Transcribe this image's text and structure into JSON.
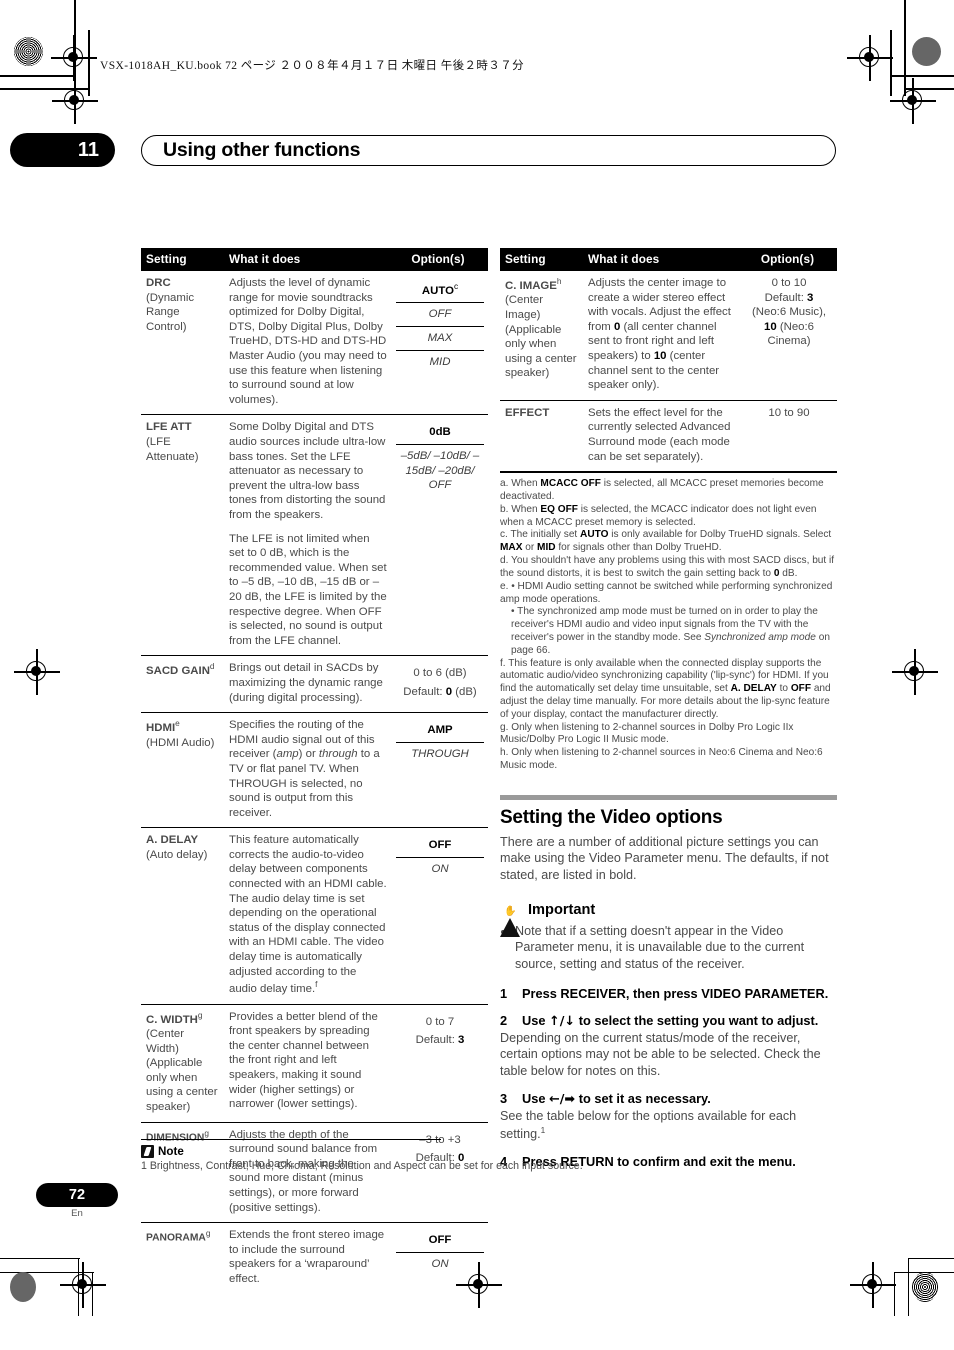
{
  "print_header": "VSX-1018AH_KU.book   72 ページ   ２００８年４月１７日   木曜日   午後２時３７分",
  "chapter": {
    "number": "11",
    "title": "Using other functions"
  },
  "left_table": {
    "headers": {
      "setting": "Setting",
      "what": "What it does",
      "options": "Option(s)"
    },
    "rows": [
      {
        "setting": "DRC",
        "setting_sup": "",
        "setting_sub": "(Dynamic Range Control)",
        "what": "Adjusts the level of dynamic range for movie soundtracks optimized for Dolby Digital, DTS, Dolby Digital Plus, Dolby TrueHD, DTS-HD and DTS-HD Master Audio (you may need to use this feature when listening to surround sound at low volumes).",
        "what2": "",
        "option_lines": [
          {
            "text": "AUTO",
            "sup": "c",
            "bold": true,
            "italic": false
          },
          {
            "text": "OFF",
            "sup": "",
            "bold": false,
            "italic": true
          },
          {
            "text": "MAX",
            "sup": "",
            "bold": false,
            "italic": true
          },
          {
            "text": "MID",
            "sup": "",
            "bold": false,
            "italic": true
          }
        ]
      },
      {
        "setting": "LFE ATT",
        "setting_sup": "",
        "setting_sub": "(LFE Attenuate)",
        "what": "Some Dolby Digital and DTS audio sources include ultra-low bass tones. Set the LFE attenuator as necessary to prevent the ultra-low bass tones from distorting the sound from the speakers.",
        "what2": "The LFE is not limited when set to 0 dB, which is the recommended value. When set to –5 dB, –10 dB, –15 dB or –20 dB, the LFE is limited by the respective degree. When OFF is selected, no sound is output from the LFE channel.",
        "option_lines": [
          {
            "text": "0dB",
            "sup": "",
            "bold": true,
            "italic": false
          },
          {
            "text": "–5dB/ –10dB/ –15dB/ –20dB/ OFF",
            "sup": "",
            "bold": false,
            "italic": true
          }
        ]
      },
      {
        "setting": "SACD GAIN",
        "setting_sup": "d",
        "setting_sub": "",
        "what": "Brings out detail in SACDs by maximizing the dynamic range (during digital processing).",
        "what2": "",
        "option_plain": "0 to 6 (dB)",
        "option_plain2_pre": "Default: ",
        "option_plain2_bold": "0",
        "option_plain2_post": " (dB)"
      },
      {
        "setting": "HDMI",
        "setting_sup": "e",
        "setting_sub": "(HDMI Audio)",
        "what": "Specifies the routing of the HDMI audio signal out of this receiver (amp) or through to a TV or flat panel TV. When THROUGH is selected, no sound is output from this receiver.",
        "what2": "",
        "option_lines": [
          {
            "text": "AMP",
            "sup": "",
            "bold": true,
            "italic": false
          },
          {
            "text": "THROUGH",
            "sup": "",
            "bold": false,
            "italic": true
          }
        ]
      },
      {
        "setting": "A. DELAY",
        "setting_sup": "",
        "setting_sub": "(Auto delay)",
        "what": "This feature automatically corrects the audio-to-video delay between components connected with an HDMI cable. The audio delay time is set depending on the operational status of the display connected with an HDMI cable. The video delay time is automatically adjusted according to the audio delay time.",
        "what_sup": "f",
        "what2": "",
        "option_lines": [
          {
            "text": "OFF",
            "sup": "",
            "bold": true,
            "italic": false
          },
          {
            "text": "ON",
            "sup": "",
            "bold": false,
            "italic": true
          }
        ]
      },
      {
        "setting": "C. WIDTH",
        "setting_sup": "g",
        "setting_sub": "(Center Width) (Applicable only when using a center speaker)",
        "what": "Provides a better blend of the front speakers by spreading the center channel between the front right and left speakers, making it sound wider (higher settings) or narrower (lower settings).",
        "what2": "",
        "option_plain": "0 to 7",
        "option_plain2_pre": "Default: ",
        "option_plain2_bold": "3",
        "option_plain2_post": ""
      },
      {
        "setting": "DIMENSION",
        "setting_sup": "g",
        "setting_sub": "",
        "setting_small": true,
        "what": "Adjusts the depth of the surround sound balance from front to back, making the sound more distant (minus settings), or more forward (positive settings).",
        "what2": "",
        "option_plain": "–3 to +3",
        "option_plain2_pre": "Default: ",
        "option_plain2_bold": "0",
        "option_plain2_post": ""
      },
      {
        "setting": "PANORAMA",
        "setting_sup": "g",
        "setting_sub": "",
        "setting_small": true,
        "what": "Extends the front stereo image to include the surround speakers for a ‘wraparound’ effect.",
        "what2": "",
        "option_lines": [
          {
            "text": "OFF",
            "sup": "",
            "bold": true,
            "italic": false
          },
          {
            "text": "ON",
            "sup": "",
            "bold": false,
            "italic": true
          }
        ]
      }
    ]
  },
  "right_table": {
    "headers": {
      "setting": "Setting",
      "what": "What it does",
      "options": "Option(s)"
    },
    "rows": [
      {
        "setting": "C. IMAGE",
        "setting_sup": "h",
        "setting_sub": "(Center Image) (Applicable only when using a center speaker)",
        "what_parts": [
          {
            "t": "Adjusts the center image to create a wider stereo effect with vocals. Adjust the effect from ",
            "b": false
          },
          {
            "t": "0",
            "b": true
          },
          {
            "t": " (all center channel sent to front right and left speakers) to ",
            "b": false
          },
          {
            "t": "10",
            "b": true
          },
          {
            "t": " (center channel sent to the center speaker only).",
            "b": false
          }
        ],
        "option_parts": [
          {
            "t": "0 to 10",
            "b": false
          },
          {
            "t": "Default: ",
            "b": false,
            "nl": true
          },
          {
            "t": "3",
            "b": true
          },
          {
            "t": "(Neo:6 Music), ",
            "b": false,
            "nl": true
          },
          {
            "t": "10",
            "b": true
          },
          {
            "t": " (Neo:6 Cinema)",
            "b": false
          }
        ]
      },
      {
        "setting": "EFFECT",
        "setting_sup": "",
        "setting_sub": "",
        "what_parts": [
          {
            "t": "Sets the effect level for the currently selected Advanced Surround mode (each mode can be set separately).",
            "b": false
          }
        ],
        "option_parts": [
          {
            "t": "10 to 90",
            "b": false
          }
        ]
      }
    ]
  },
  "footnotes": [
    {
      "parts": [
        {
          "t": "a. When ",
          "b": false
        },
        {
          "t": "MCACC OFF",
          "b": true
        },
        {
          "t": " is selected, all MCACC preset memories become deactivated.",
          "b": false
        }
      ]
    },
    {
      "parts": [
        {
          "t": "b. When ",
          "b": false
        },
        {
          "t": "EQ OFF",
          "b": true
        },
        {
          "t": " is selected, the MCACC indicator does not light even when a MCACC preset memory is selected.",
          "b": false
        }
      ]
    },
    {
      "parts": [
        {
          "t": "c. The initially set ",
          "b": false
        },
        {
          "t": "AUTO",
          "b": true
        },
        {
          "t": " is only available for Dolby TrueHD signals. Select ",
          "b": false
        },
        {
          "t": "MAX",
          "b": true
        },
        {
          "t": " or ",
          "b": false
        },
        {
          "t": "MID",
          "b": true
        },
        {
          "t": " for signals other than Dolby TrueHD.",
          "b": false
        }
      ]
    },
    {
      "parts": [
        {
          "t": "d. You shouldn't have any problems using this with most SACD discs, but if the sound distorts, it is best to switch the gain setting back to ",
          "b": false
        },
        {
          "t": "0",
          "b": true
        },
        {
          "t": " dB.",
          "b": false
        }
      ]
    },
    {
      "parts": [
        {
          "t": "e. • HDMI Audio setting cannot be switched while performing synchronized amp mode operations.",
          "b": false
        }
      ]
    },
    {
      "indent": true,
      "parts": [
        {
          "t": "• The synchronized amp mode must be turned on in order to play the receiver's HDMI audio and video input signals from the TV with the receiver's power in the standby mode. See ",
          "b": false
        },
        {
          "t": "Synchronized amp mode",
          "i": true
        },
        {
          "t": " on page 66.",
          "b": false
        }
      ]
    },
    {
      "parts": [
        {
          "t": "f. This feature is only available when the connected display supports the automatic audio/video synchronizing capability ('lip-sync') for HDMI. If you find the automatically set delay time unsuitable, set ",
          "b": false
        },
        {
          "t": "A. DELAY",
          "b": true
        },
        {
          "t": " to ",
          "b": false
        },
        {
          "t": "OFF",
          "b": true
        },
        {
          "t": " and adjust the delay time manually. For more details about the lip-sync feature of your display, contact the manufacturer directly.",
          "b": false
        }
      ]
    },
    {
      "parts": [
        {
          "t": "g. Only when listening to 2-channel sources in Dolby Pro Logic IIx Music/Dolby Pro Logic II Music mode.",
          "b": false
        }
      ]
    },
    {
      "parts": [
        {
          "t": "h. Only when listening to 2-channel sources in Neo:6 Cinema and Neo:6 Music mode.",
          "b": false
        }
      ]
    }
  ],
  "video_section": {
    "title": "Setting the Video options",
    "intro": "There are a number of additional picture settings you can make using the Video Parameter menu. The defaults, if not stated, are listed in bold.",
    "important_label": "Important",
    "important_bullets": [
      "Note that if a setting doesn't appear in the Video Parameter menu, it is unavailable due to the current source, setting and status of the receiver."
    ],
    "steps": [
      {
        "num": "1",
        "head": "Press RECEIVER, then press VIDEO PARAMETER.",
        "body": ""
      },
      {
        "num": "2",
        "head_pre": "Use ",
        "head_arrows": "↑/↓",
        "head_post": " to select the setting you want to adjust.",
        "body": "Depending on the current status/mode of the receiver, certain options may not be able to be selected. Check the table below for notes on this."
      },
      {
        "num": "3",
        "head_pre": "Use ",
        "head_arrows": "←/➡",
        "head_post": " to set it as necessary.",
        "body": "See the table below for the options available for each setting.",
        "body_sup": "1"
      },
      {
        "num": "4",
        "head": "Press RETURN to confirm and exit the menu.",
        "body": ""
      }
    ]
  },
  "bottom_note": {
    "title": "Note",
    "text": "1 Brightness, Contrast, Hue, Chroma, Resolution and Aspect can be set for each input source."
  },
  "page": {
    "number": "72",
    "lang": "En"
  }
}
